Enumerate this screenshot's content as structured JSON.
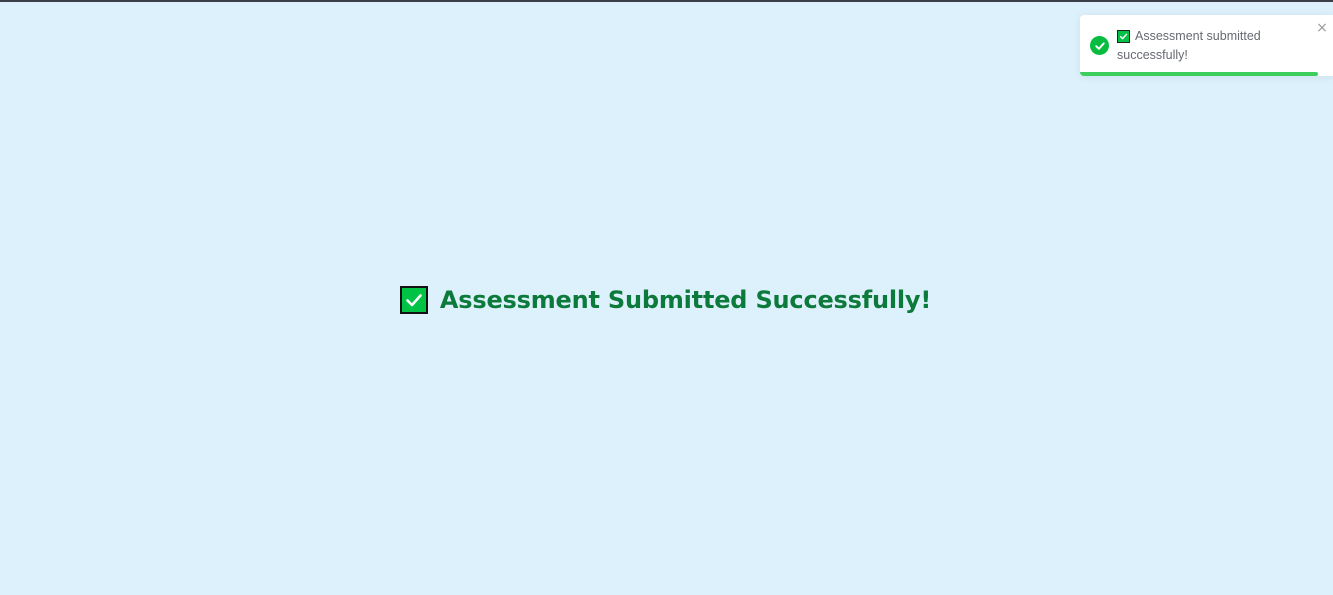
{
  "page": {
    "background_color": "#ddf1fd",
    "top_border_color": "#3a3f4a"
  },
  "main": {
    "icon": "check-box-icon",
    "title": "Assessment Submitted Successfully!",
    "title_color": "#0c7a3a",
    "icon_color": "#00c244"
  },
  "toast": {
    "status_icon": "check-circle-icon",
    "inline_icon": "check-box-icon",
    "message": "Assessment submitted successfully!",
    "close_label": "×",
    "close_icon": "close-icon",
    "progress_fraction": 0.94,
    "success_color": "#07bc3f",
    "progress_color": "#3ccf5e"
  }
}
